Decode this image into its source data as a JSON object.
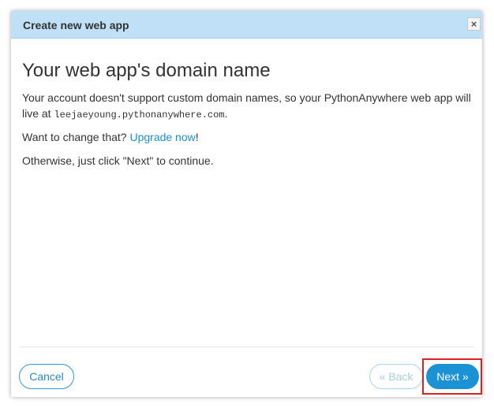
{
  "dialog": {
    "title": "Create new web app",
    "close_glyph": "×",
    "close_icon": "close-icon"
  },
  "content": {
    "heading": "Your web app's domain name",
    "p1_text": "Your account doesn't support custom domain names, so your PythonAnywhere web app will live at ",
    "p1_domain": "leejaeyoung.pythonanywhere.com",
    "p1_end": ".",
    "p2_text": "Want to change that? ",
    "p2_link": "Upgrade now",
    "p2_end": "!",
    "p3_text": "Otherwise, just click \"Next\" to continue."
  },
  "footer": {
    "cancel_label": "Cancel",
    "back_label": "« Back",
    "next_label": "Next »"
  },
  "colors": {
    "header_bg": "#bfe0f6",
    "accent": "#1a92d3",
    "highlight": "#e02020"
  }
}
